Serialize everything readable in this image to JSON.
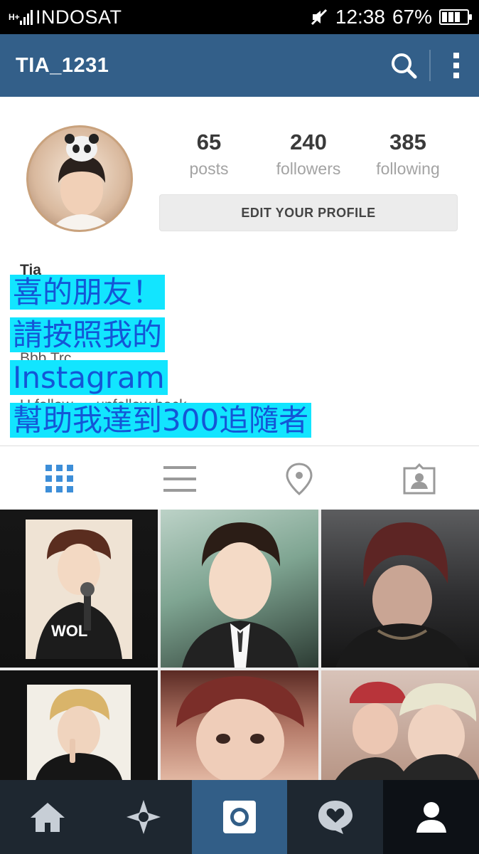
{
  "status_bar": {
    "network_type": "H+",
    "carrier": "INDOSAT",
    "time": "12:38",
    "battery_percent": "67%",
    "battery_level": 0.67,
    "signal_icon": "signal-bars-icon",
    "mute_icon": "mute-icon"
  },
  "app_bar": {
    "title": "TIA_1231",
    "search_icon": "search-icon",
    "menu_icon": "overflow-menu-icon",
    "background_color": "#335f89"
  },
  "profile": {
    "stats": [
      {
        "value": "65",
        "label": "posts"
      },
      {
        "value": "240",
        "label": "followers"
      },
      {
        "value": "385",
        "label": "following"
      }
    ],
    "edit_button_label": "EDIT YOUR PROFILE",
    "bio_name": "Tia",
    "bio_line_1": "Bbb Trc",
    "bio_line_2": "U follow → unfollow back"
  },
  "overlay_text": {
    "lines": [
      "喜的朋友！",
      "請按照我的",
      "Instagram",
      "幫助我達到300追隨者"
    ],
    "highlight_color": "#12e5ff",
    "text_color": "#1456d6"
  },
  "tabs": [
    {
      "name": "grid-view",
      "icon": "grid-icon",
      "active": true
    },
    {
      "name": "list-view",
      "icon": "list-icon",
      "active": false
    },
    {
      "name": "photo-map",
      "icon": "location-pin-icon",
      "active": false
    },
    {
      "name": "photos-of-you",
      "icon": "tagged-person-icon",
      "active": false
    }
  ],
  "photo_grid": [
    {
      "caption": "",
      "description": "boy with headphones and microphone"
    },
    {
      "caption": "",
      "description": "boy in suit portrait"
    },
    {
      "caption": "",
      "description": "boy in dark jacket"
    },
    {
      "caption": "",
      "description": "blond boy finger to lips"
    },
    {
      "caption": "",
      "description": "boy with red hair close-up"
    },
    {
      "caption": "",
      "description": "two boys selfie"
    }
  ],
  "bottom_nav": [
    {
      "name": "home",
      "icon": "home-icon",
      "active": false
    },
    {
      "name": "explore",
      "icon": "explore-icon",
      "active": false
    },
    {
      "name": "camera",
      "icon": "camera-icon",
      "active": true
    },
    {
      "name": "activity",
      "icon": "activity-heart-icon",
      "active": false
    },
    {
      "name": "profile",
      "icon": "profile-icon",
      "active": true
    }
  ]
}
